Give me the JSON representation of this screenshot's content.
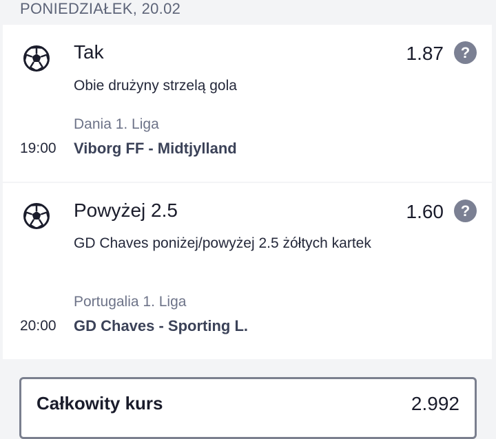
{
  "header": {
    "date": "PONIEDZIAŁEK, 20.02"
  },
  "bets": [
    {
      "sport_icon": "soccer-ball-icon",
      "selection": "Tak",
      "odds": "1.87",
      "market": "Obie drużyny strzelą gola",
      "league": "Dania 1. Liga",
      "time": "19:00",
      "teams": "Viborg FF - Midtjylland",
      "help_label": "?"
    },
    {
      "sport_icon": "soccer-ball-icon",
      "selection": "Powyżej 2.5",
      "odds": "1.60",
      "market": "GD Chaves poniżej/powyżej 2.5 żółtych kartek",
      "league": "Portugalia 1. Liga",
      "time": "20:00",
      "teams": "GD Chaves - Sporting L.",
      "help_label": "?"
    }
  ],
  "total": {
    "label": "Całkowity kurs",
    "value": "2.992"
  },
  "colors": {
    "help_bg": "#7b8093",
    "accent_text": "#3b4258",
    "border": "#7a7f8e"
  }
}
